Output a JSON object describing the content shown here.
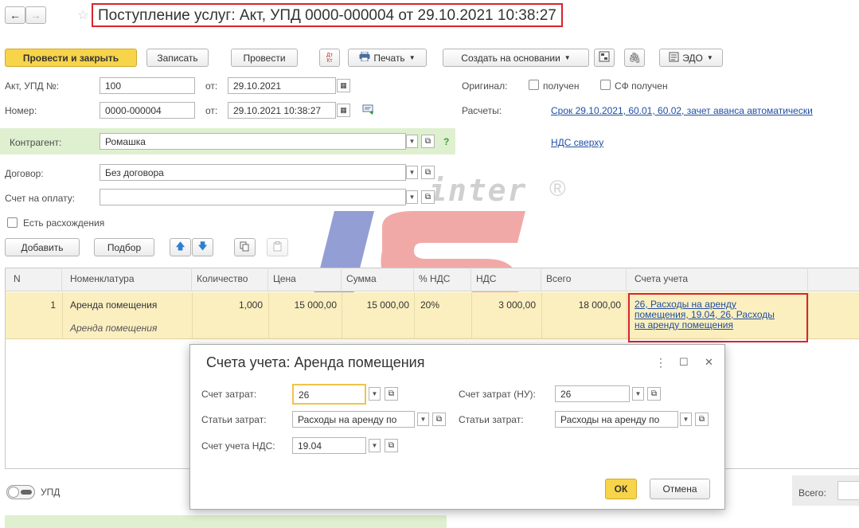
{
  "window": {
    "title": "Поступление услуг: Акт, УПД 0000-000004 от 29.10.2021 10:38:27"
  },
  "toolbar": {
    "post_close": "Провести и закрыть",
    "save": "Записать",
    "post": "Провести",
    "dtkt": "Дт Кт",
    "print": "Печать",
    "create_based": "Создать на основании",
    "edo": "ЭДО"
  },
  "form": {
    "act_label": "Акт, УПД №:",
    "act_number": "100",
    "from_label": "от:",
    "act_date": "29.10.2021",
    "number_label": "Номер:",
    "number": "0000-000004",
    "number_date": "29.10.2021 10:38:27",
    "original_label": "Оригинал:",
    "received": "получен",
    "sf_received": "СФ получен",
    "settlements_label": "Расчеты:",
    "settlements_link": "Срок 29.10.2021, 60.01, 60.02, зачет аванса автоматически",
    "counterparty_label": "Контрагент:",
    "counterparty": "Ромашка",
    "help": "?",
    "vat_link": "НДС сверху",
    "contract_label": "Договор:",
    "contract": "Без договора",
    "invoice_label": "Счет на оплату:",
    "invoice": "",
    "discrepancy": "Есть расхождения"
  },
  "table_toolbar": {
    "add": "Добавить",
    "pick": "Подбор"
  },
  "table": {
    "headers": [
      "N",
      "Номенклатура",
      "Количество",
      "Цена",
      "Сумма",
      "% НДС",
      "НДС",
      "Всего",
      "Счета учета"
    ],
    "row": {
      "n": "1",
      "item": "Аренда помещения",
      "item_sub": "Аренда помещения",
      "qty": "1,000",
      "price": "15 000,00",
      "sum": "15 000,00",
      "vat_rate": "20%",
      "vat": "3 000,00",
      "total": "18 000,00",
      "accounts_line1": "26, Расходы на аренду",
      "accounts_line2": "помещения, 19.04, 26, Расходы",
      "accounts_line3": "на аренду помещения"
    }
  },
  "watermark": {
    "inter": "inter",
    "soft": "soft",
    "reg": "®"
  },
  "footer": {
    "upd": "УПД",
    "total_label": "Всего:"
  },
  "dialog": {
    "title": "Счета учета: Аренда помещения",
    "cost_account_label": "Счет затрат:",
    "cost_account": "26",
    "cost_account_nu_label": "Счет затрат (НУ):",
    "cost_account_nu": "26",
    "cost_items_label": "Статьи затрат:",
    "cost_items": "Расходы на аренду по",
    "cost_items_nu_label": "Статьи затрат:",
    "cost_items_nu": "Расходы на аренду по",
    "vat_account_label": "Счет учета НДС:",
    "vat_account": "19.04",
    "ok": "ОК",
    "cancel": "Отмена",
    "more": "⋮",
    "maximize": "☐",
    "close": "✕"
  },
  "colors": {
    "accent": "#f7d44a",
    "highlight_row": "#fbefc0",
    "counterparty_bg": "#dff0d0",
    "annotation_red": "#d9232d",
    "link": "#1f4fa3"
  }
}
